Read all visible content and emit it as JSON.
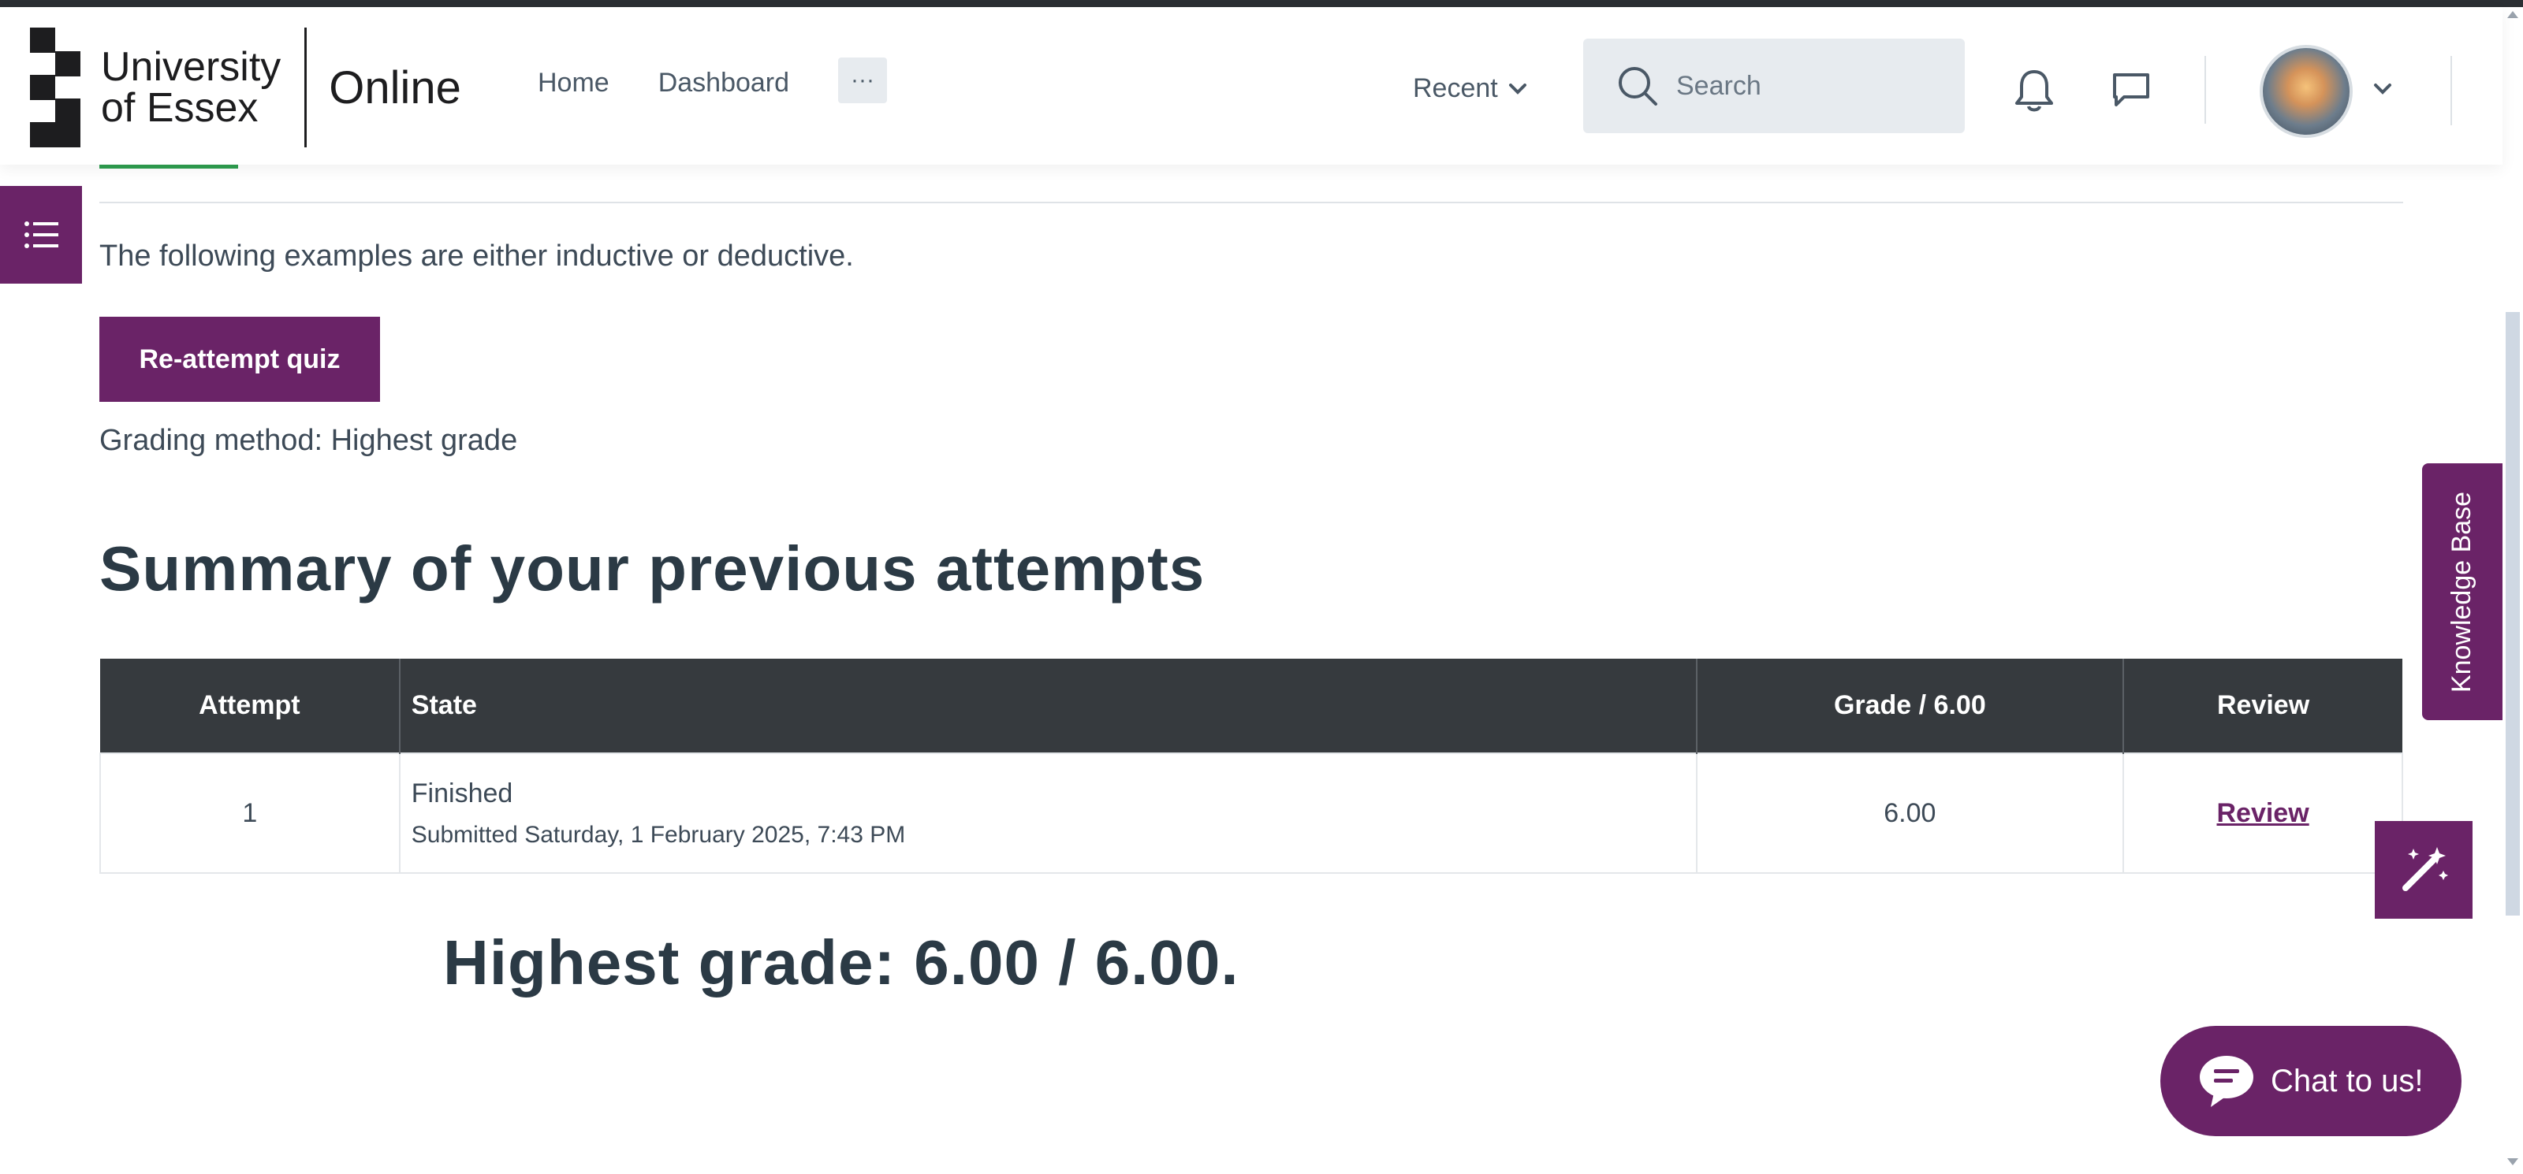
{
  "brand": {
    "line1": "University",
    "line2": "of Essex",
    "product": "Online",
    "accent_color": "#6a2367",
    "success_color": "#2e9e4f"
  },
  "nav": {
    "links": [
      "Home",
      "Dashboard"
    ],
    "more_label": "···",
    "recent_label": "Recent",
    "search_placeholder": "Search"
  },
  "icons": {
    "drawer": "list-icon",
    "search": "search-icon",
    "notifications": "bell-icon",
    "messages": "chat-bubble-icon",
    "chevron": "chevron-down-icon",
    "magic": "magic-wand-icon",
    "chat": "chat-icon"
  },
  "content": {
    "intro": "The following examples are either inductive or deductive.",
    "reattempt_label": "Re-attempt quiz",
    "grading_method": "Grading method: Highest grade",
    "summary_heading": "Summary of your previous attempts",
    "table": {
      "headers": [
        "Attempt",
        "State",
        "Grade / 6.00",
        "Review"
      ],
      "rows": [
        {
          "attempt": "1",
          "state": "Finished",
          "submitted": "Submitted Saturday, 1 February 2025, 7:43 PM",
          "grade": "6.00",
          "review": "Review"
        }
      ]
    },
    "highest_grade": "Highest grade: 6.00 / 6.00."
  },
  "widgets": {
    "knowledge_base": "Knowledge Base",
    "chat_label": "Chat to us!"
  }
}
